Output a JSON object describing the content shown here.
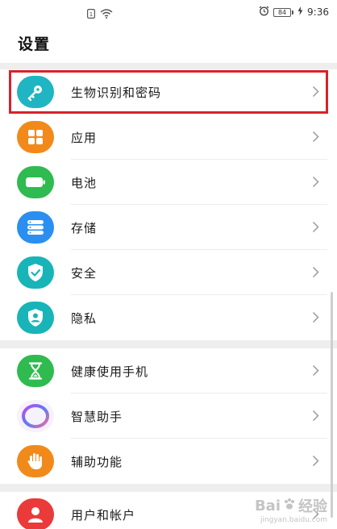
{
  "status_bar": {
    "battery_level": "84",
    "time": "9:36"
  },
  "header": {
    "title": "设置"
  },
  "groups": [
    {
      "items": [
        {
          "label": "生物识别和密码",
          "icon": "key-icon",
          "color": "#1fb5c2"
        },
        {
          "label": "应用",
          "icon": "apps-grid-icon",
          "color": "#f18a1b"
        },
        {
          "label": "电池",
          "icon": "battery-icon",
          "color": "#2fbb4f"
        },
        {
          "label": "存储",
          "icon": "storage-icon",
          "color": "#2a8ff0"
        },
        {
          "label": "安全",
          "icon": "shield-check-icon",
          "color": "#18b4b8"
        },
        {
          "label": "隐私",
          "icon": "privacy-shield-icon",
          "color": "#18b4b8"
        }
      ]
    },
    {
      "items": [
        {
          "label": "健康使用手机",
          "icon": "hourglass-icon",
          "color": "#2fbb4f"
        },
        {
          "label": "智慧助手",
          "icon": "assistant-ring-icon",
          "color": "#9b7cf0"
        },
        {
          "label": "辅助功能",
          "icon": "hand-icon",
          "color": "#f18a1b"
        }
      ]
    },
    {
      "items": [
        {
          "label": "用户和帐户",
          "icon": "user-icon",
          "color": "#ea3a3a"
        }
      ]
    }
  ],
  "watermark": {
    "brand": "Bai",
    "brand_suffix": "经验",
    "url": "jingyan.baidu.com"
  },
  "colors": {
    "highlight_border": "#d8222a",
    "divider": "#ececec",
    "group_gap": "#eeeeee"
  }
}
